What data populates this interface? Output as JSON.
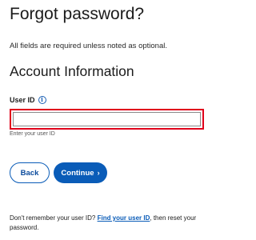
{
  "page": {
    "title": "Forgot password?",
    "required_note": "All fields are required unless noted as optional."
  },
  "section": {
    "title": "Account Information"
  },
  "user_id_field": {
    "label": "User ID",
    "info_icon": "info-icon",
    "value": "",
    "helper_text": "Enter your user ID",
    "highlight_color": "#e0001b"
  },
  "buttons": {
    "back_label": "Back",
    "continue_label": "Continue",
    "continue_icon": "chevron-right-icon",
    "primary_color": "#0a5cb8"
  },
  "footer": {
    "text_before": "Don't remember your user ID? ",
    "link_label": "Find your user ID",
    "text_after": ", then reset your password."
  }
}
